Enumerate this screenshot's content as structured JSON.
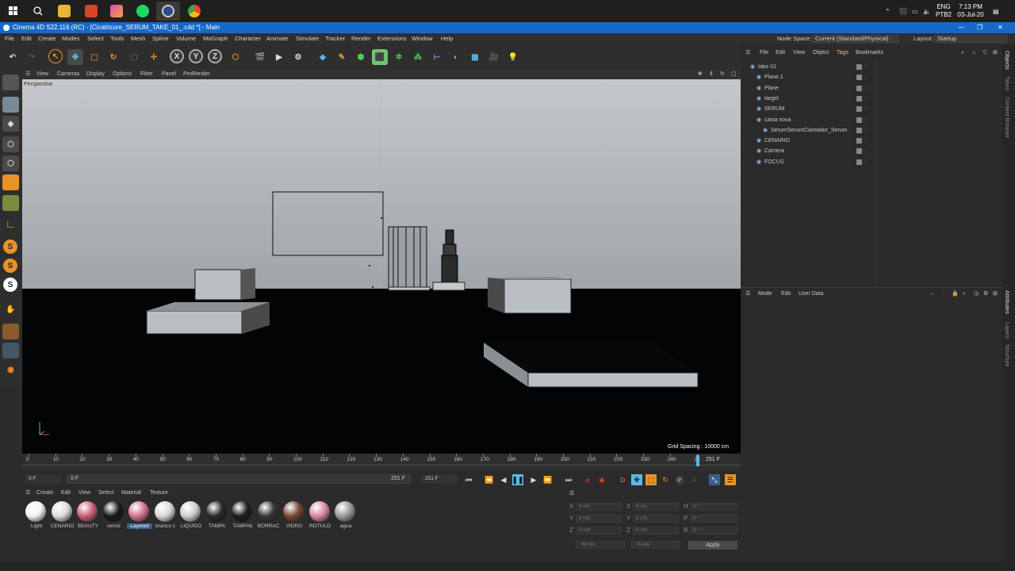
{
  "taskbar": {
    "lang": "ENG",
    "layout": "PTB2",
    "time": "7:13 PM",
    "date": "03-Jul-20"
  },
  "titlebar": {
    "title": "Cinema 4D S22.116 (RC) - [Cicatricure_SERUM_TAKE_01_.c4d *] - Main"
  },
  "menu": {
    "items": [
      "File",
      "Edit",
      "Create",
      "Modes",
      "Select",
      "Tools",
      "Mesh",
      "Spline",
      "Volume",
      "MoGraph",
      "Character",
      "Animate",
      "Simulate",
      "Tracker",
      "Render",
      "Extensions",
      "Window",
      "Help"
    ],
    "node_space_label": "Node Space:",
    "node_space_value": "Current (Standard/Physical)",
    "layout_label": "Layout:",
    "layout_value": "Startup"
  },
  "toolbar": {
    "axis_x": "X",
    "axis_y": "Y",
    "axis_z": "Z"
  },
  "lefttools": {
    "s1": "S",
    "s2": "S",
    "s3": "S"
  },
  "viewport": {
    "menu": [
      "View",
      "Cameras",
      "Display",
      "Options",
      "Filter",
      "Panel",
      "ProRender"
    ],
    "label": "Perspective",
    "grid_spacing": "Grid Spacing : 10000 cm"
  },
  "timeline": {
    "ticks": [
      "0",
      "10",
      "20",
      "30",
      "40",
      "50",
      "60",
      "70",
      "80",
      "90",
      "100",
      "110",
      "120",
      "130",
      "140",
      "150",
      "160",
      "170",
      "180",
      "190",
      "200",
      "210",
      "220",
      "230",
      "240",
      "25"
    ],
    "current_frame": "251 F"
  },
  "playbar": {
    "start": "0 F",
    "min": "0 F",
    "max": "251 F",
    "end": "251 F"
  },
  "materials": {
    "menu": [
      "Create",
      "Edit",
      "View",
      "Select",
      "Material",
      "Texture"
    ],
    "items": [
      {
        "name": "Light",
        "color": "#f2f2f2"
      },
      {
        "name": "CENARIO",
        "color": "#dcdcdc"
      },
      {
        "name": "BEAUTY",
        "color": "#c9607a"
      },
      {
        "name": "verniz",
        "color": "#1a1a1a"
      },
      {
        "name": "Layered",
        "color": "#d4748e"
      },
      {
        "name": "branco c",
        "color": "#d8d8d8"
      },
      {
        "name": "LIQUIDO",
        "color": "#cfcfcf"
      },
      {
        "name": "TAMPA",
        "color": "#2a2a2a"
      },
      {
        "name": "TAMPAb",
        "color": "#1e1e1e"
      },
      {
        "name": "BORRAC",
        "color": "#3a3a3a"
      },
      {
        "name": "VIDRO",
        "color": "#7a4a33"
      },
      {
        "name": "ROTULO",
        "color": "#d98aa0"
      },
      {
        "name": "agua",
        "color": "#9a9a9a"
      }
    ]
  },
  "coords": {
    "x_label": "X",
    "y_label": "Y",
    "z_label": "Z",
    "pos_x": "0 cm",
    "pos_y": "0 cm",
    "pos_z": "0 cm",
    "size_x": "0 cm",
    "size_y": "0 cm",
    "size_z": "0 cm",
    "h_label": "H",
    "p_label": "P",
    "b_label": "B",
    "rot_h": "0 °",
    "rot_p": "0 °",
    "rot_b": "0 °",
    "world": "World",
    "scale": "Scale",
    "apply": "Apply"
  },
  "objects": {
    "menu": [
      "File",
      "Edit",
      "View",
      "Object",
      "Tags",
      "Bookmarks"
    ],
    "rows": [
      {
        "name": "take 01",
        "indent": 0
      },
      {
        "name": "Plane.1",
        "indent": 1
      },
      {
        "name": "Plane",
        "indent": 1
      },
      {
        "name": "target",
        "indent": 1
      },
      {
        "name": "SERUM",
        "indent": 1
      },
      {
        "name": "caixa nova",
        "indent": 1
      },
      {
        "name": "SerumSerumClareador_Serum",
        "indent": 2
      },
      {
        "name": "CENARIO",
        "indent": 1
      },
      {
        "name": "Camera",
        "indent": 1
      },
      {
        "name": "FOCUS",
        "indent": 1
      }
    ]
  },
  "attributes": {
    "menu": [
      "Mode",
      "Edit",
      "User Data"
    ]
  },
  "righttabs": {
    "top": [
      "Objects",
      "Takes",
      "Content Browser"
    ],
    "bottom": [
      "Attributes",
      "Layers",
      "Structure"
    ]
  },
  "colors": {
    "accent": "#1669c9",
    "orange": "#e8922a",
    "cyan": "#5ab8e6",
    "green": "#4ec94e"
  }
}
